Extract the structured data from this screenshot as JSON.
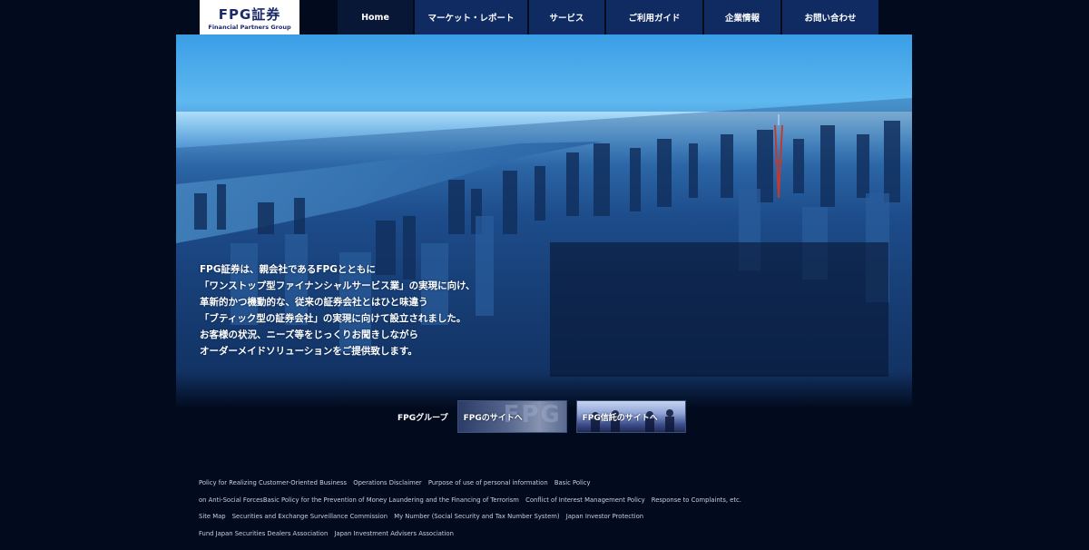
{
  "logo": {
    "main": "FPG証券",
    "sub": "Financial Partners Group"
  },
  "nav": [
    {
      "label": "Home"
    },
    {
      "label": "マーケット・レポート"
    },
    {
      "label": "サービス"
    },
    {
      "label": "ご利用ガイド"
    },
    {
      "label": "企業情報"
    },
    {
      "label": "お問い合わせ"
    }
  ],
  "hero": {
    "lines": [
      "FPG証券は、親会社であるFPGとともに",
      "「ワンストップ型ファイナンシャルサービス業」の実現に向け、",
      "革新的かつ機動的な、従来の証券会社とはひと味違う",
      "「ブティック型の証券会社」の実現に向けて設立されました。",
      "お客様の状況、ニーズ等をじっくりお聞きしながら",
      "オーダーメイドソリューションをご提供致します。"
    ]
  },
  "group": {
    "label": "FPGグループ",
    "fpg_link": "FPGのサイトへ",
    "fpg_bg": "FPG",
    "shintaku_link": "FPG信託のサイトへ"
  },
  "footer": {
    "line1": [
      "Policy for Realizing Customer-Oriented Business",
      "Operations Disclaimer",
      "Purpose of use of personal information",
      "Basic Policy"
    ],
    "line2": [
      "on Anti-Social ForcesBasic Policy for the Prevention of Money Laundering and the Financing of Terrorism",
      "Conflict of Interest Management Policy",
      "Response to Complaints, etc."
    ],
    "line3": [
      "Site Map",
      "Securities and Exchange Surveillance Commission",
      "My Number (Social Security and Tax Number System)",
      "Japan Investor Protection"
    ],
    "line4": [
      "Fund Japan Securities Dealers Association",
      "Japan Investment Advisers Association"
    ]
  },
  "colors": {
    "background": "#020b1e",
    "nav": "#0f2b62",
    "nav_active": "#091737",
    "logo_text": "#1c2a6b"
  }
}
